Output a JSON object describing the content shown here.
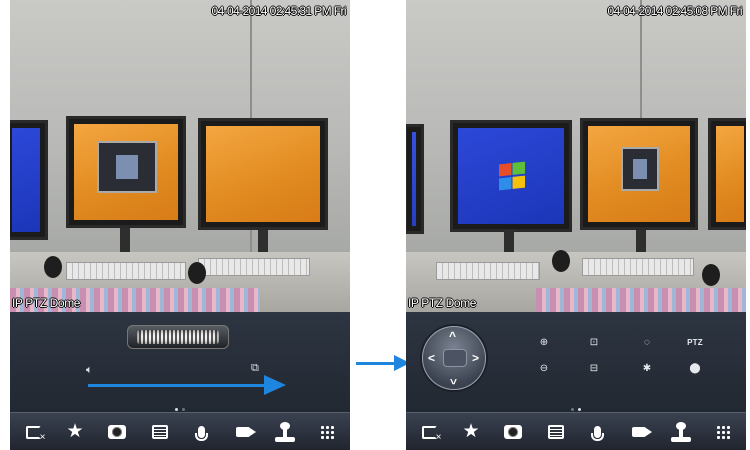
{
  "left_screen": {
    "timestamp": "04-04-2014 02:45:31 PM Fri",
    "camera_label": "IP PTZ Dome",
    "page_indicator": {
      "count": 2,
      "active": 1
    },
    "icons": [
      "mute-speaker-icon",
      "copy-icon",
      "jog-dial"
    ]
  },
  "right_screen": {
    "timestamp": "04-04-2014 02:45:08 PM Fri",
    "camera_label": "IP PTZ Dome",
    "page_indicator": {
      "count": 2,
      "active": 2
    },
    "ptz": {
      "label": "PTZ"
    },
    "icons": [
      "zoom-in-icon",
      "zoom-out-icon",
      "focus-near-icon",
      "focus-far-icon",
      "iris-open-icon",
      "iris-close-icon",
      "preset-location-icon",
      "directional-pad"
    ]
  },
  "toolbar": {
    "icons": [
      "close-stream-icon",
      "favorite-star-icon",
      "snapshot-icon",
      "list-icon",
      "microphone-icon",
      "record-video-icon",
      "joystick-icon",
      "grid-menu-icon"
    ]
  },
  "colors": {
    "accent_arrow": "#1f86e0",
    "panel": "#2a313c",
    "toolbar": "#2a303a"
  }
}
